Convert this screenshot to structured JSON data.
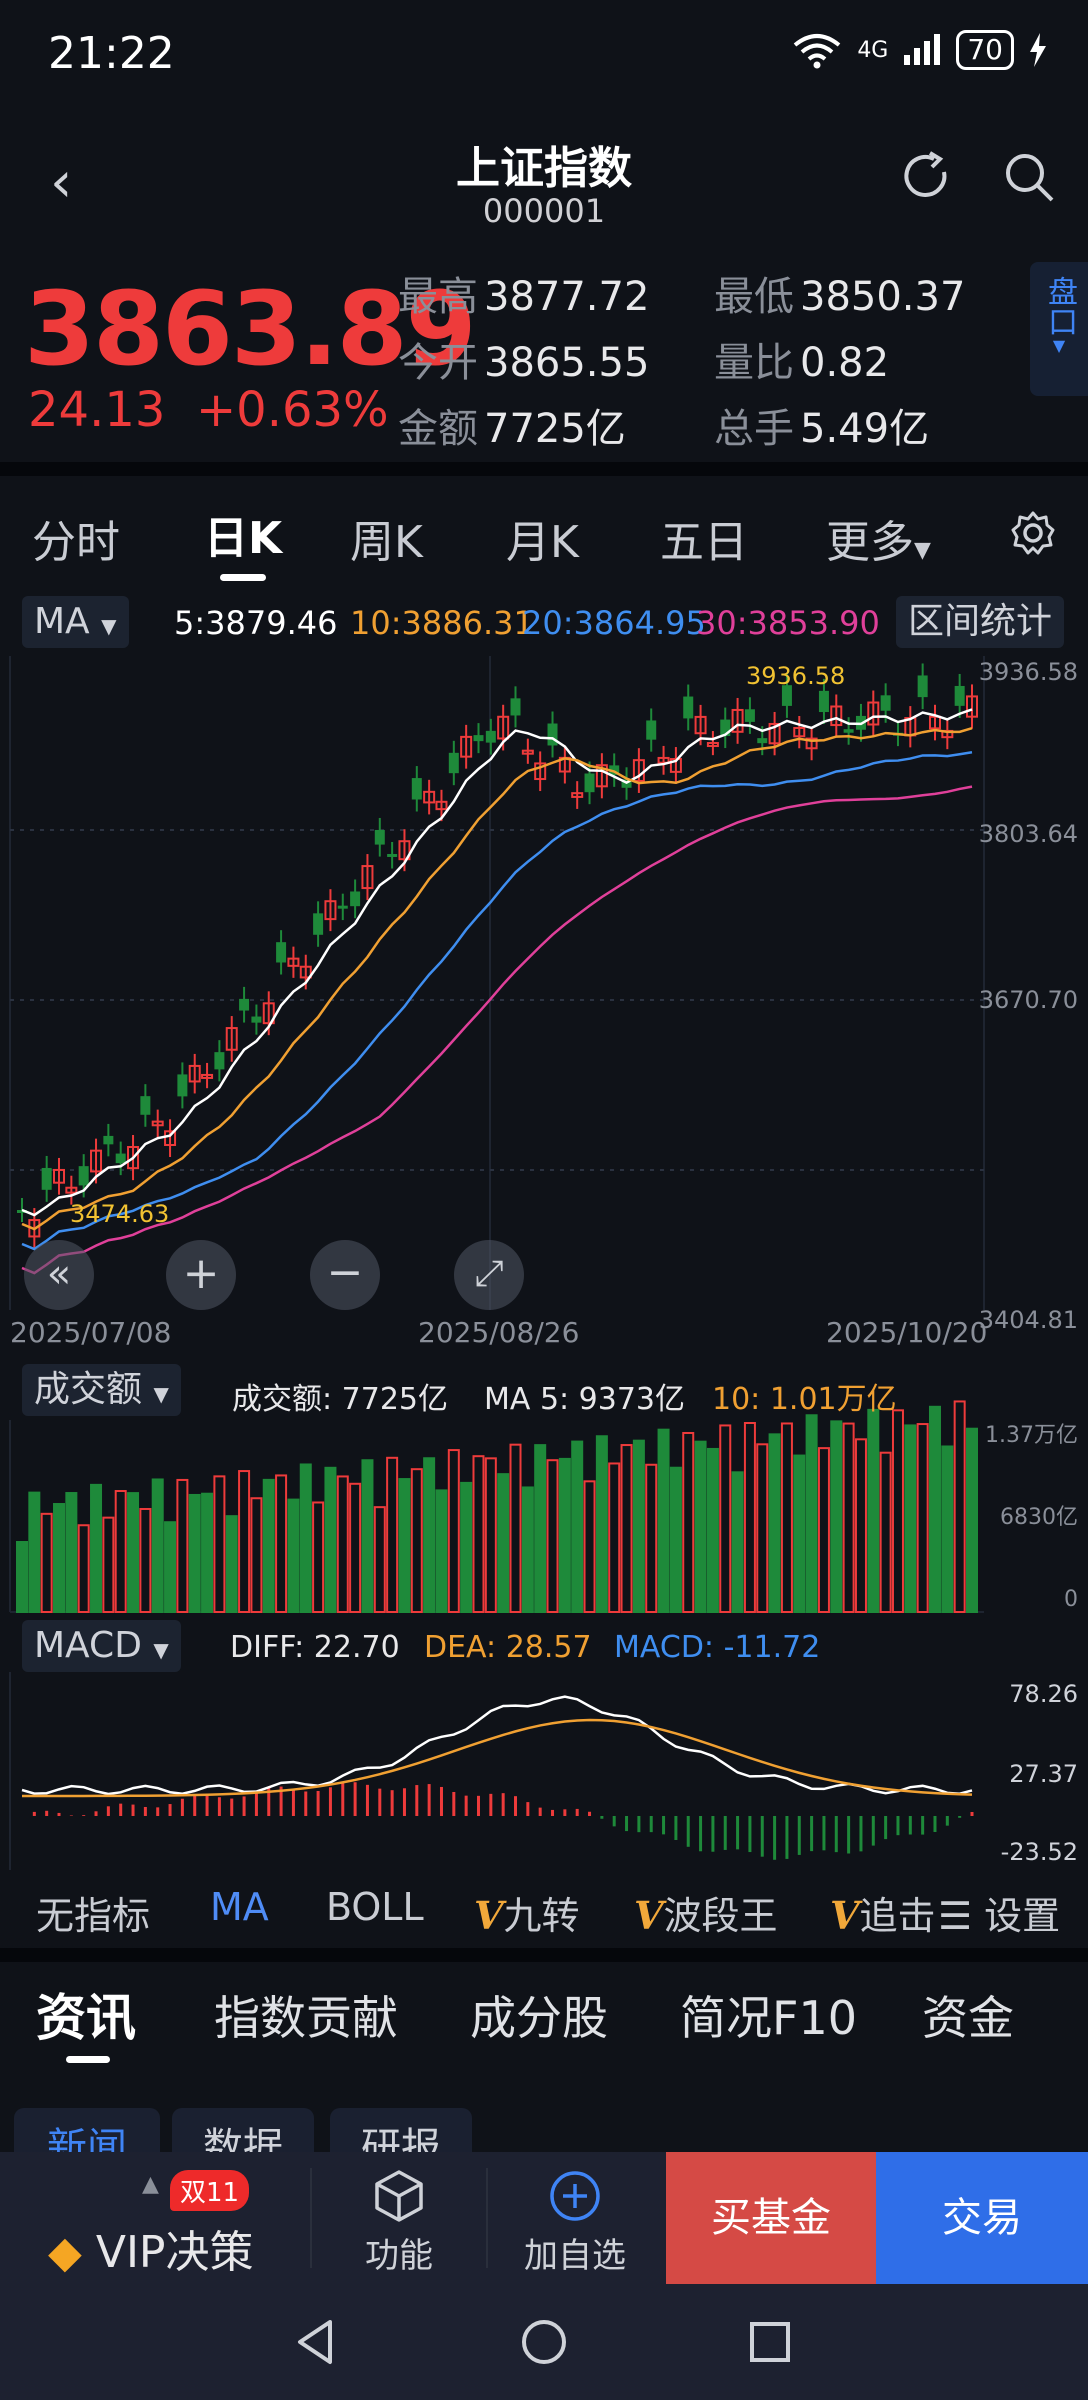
{
  "status_bar": {
    "time": "21:22",
    "network": "4G",
    "battery": "70"
  },
  "header": {
    "title": "上证指数",
    "code": "000001"
  },
  "quote": {
    "price": "3863.89",
    "change": "24.13",
    "change_pct": "+0.63%",
    "high_label": "最高",
    "high": "3877.72",
    "low_label": "最低",
    "low": "3850.37",
    "open_label": "今开",
    "open": "3865.55",
    "ratio_label": "量比",
    "ratio": "0.82",
    "amount_label": "金额",
    "amount": "7725亿",
    "turnover_label": "总手",
    "turnover": "5.49亿",
    "pankou_label": "盘口"
  },
  "period_tabs": [
    "分时",
    "日K",
    "周K",
    "月K",
    "五日",
    "更多"
  ],
  "active_tab": "日K",
  "ma_bar": {
    "selector": "MA",
    "ma5": "5:3879.46",
    "ma10": "10:3886.31",
    "ma20": "20:3864.95",
    "ma30": "30:3853.90",
    "range_stats": "区间统计"
  },
  "colors": {
    "up": "#ee3b3b",
    "down": "#1e8a3a",
    "ma5": "#ffffff",
    "ma10": "#f0a032",
    "ma20": "#3f8ef0",
    "ma30": "#e0409a",
    "bg": "#0f1218",
    "accent_blue": "#2f6ee8",
    "accent_red": "#d54a45"
  },
  "kline": {
    "y_labels": [
      "3936.58",
      "3803.64",
      "3670.70",
      "3404.81"
    ],
    "high_mark": "3936.58",
    "low_mark": "3474.63",
    "dates": [
      "2025/07/08",
      "2025/08/26",
      "2025/10/20"
    ]
  },
  "volume": {
    "selector": "成交额",
    "label": "成交额: 7725亿",
    "ma5": "MA 5: 9373亿",
    "ma10": "10: 1.01万亿",
    "y_labels": [
      "1.37万亿",
      "6830亿",
      "0"
    ]
  },
  "macd": {
    "selector": "MACD",
    "diff": "DIFF: 22.70",
    "dea": "DEA: 28.57",
    "macd": "MACD: -11.72",
    "y_labels": [
      "78.26",
      "27.37",
      "-23.52"
    ]
  },
  "indicators": {
    "items": [
      "无指标",
      "MA",
      "BOLL",
      "九转",
      "波段王",
      "追击"
    ],
    "settings": "设置"
  },
  "bottom_tabs": [
    "资讯",
    "指数贡献",
    "成分股",
    "简况F10",
    "资金"
  ],
  "news_subtabs": [
    "新闻",
    "数据",
    "研报"
  ],
  "actionbar": {
    "vip_label": "VIP决策",
    "badge": "双11",
    "func_label": "功能",
    "add_label": "加自选",
    "buy_fund": "买基金",
    "trade": "交易"
  }
}
